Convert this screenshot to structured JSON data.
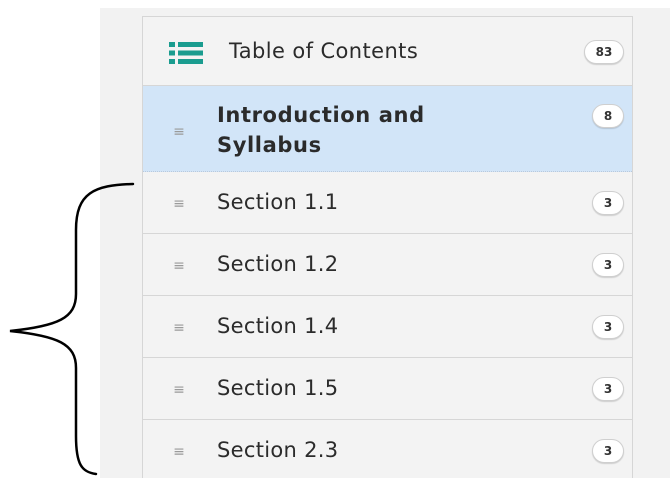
{
  "toc": {
    "header": {
      "title": "Table of Contents",
      "count": "83",
      "icon": "list-icon",
      "icon_color": "#1a9c8f"
    },
    "items": [
      {
        "label": "Introduction and Syllabus",
        "count": "8",
        "active": true
      },
      {
        "label": "Section 1.1",
        "count": "3",
        "active": false
      },
      {
        "label": "Section 1.2",
        "count": "3",
        "active": false
      },
      {
        "label": "Section 1.4",
        "count": "3",
        "active": false
      },
      {
        "label": "Section 1.5",
        "count": "3",
        "active": false
      },
      {
        "label": "Section 2.3",
        "count": "3",
        "active": false
      }
    ]
  },
  "colors": {
    "active_row": "#d2e5f8",
    "row_background": "#f3f3f3",
    "border": "#d6d6d6"
  },
  "annotation": {
    "icon": "curly-brace-icon"
  }
}
